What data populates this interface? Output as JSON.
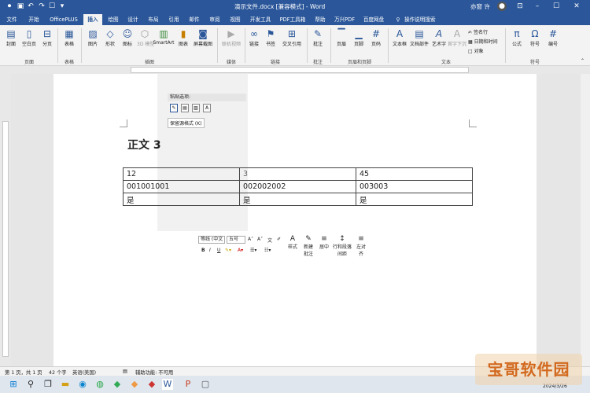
{
  "titlebar": {
    "title": "演示文件.docx [兼容模式] - Word",
    "user": "亦窗 许",
    "icons": [
      "save-icon",
      "undo-icon",
      "redo-icon",
      "touch-mode-icon",
      "customize-icon"
    ]
  },
  "tabs": [
    "文件",
    "开始",
    "OfficePLUS",
    "插入",
    "绘图",
    "设计",
    "布局",
    "引用",
    "邮件",
    "审阅",
    "视图",
    "开发工具",
    "PDF工具箱",
    "帮助",
    "万兴PDF",
    "百度网盘",
    "操作说明搜索"
  ],
  "active_tab": "插入",
  "ribbon": {
    "groups": {
      "pages": "页面",
      "tables": "表格",
      "illustrations": "插图",
      "media": "媒体",
      "links": "链接",
      "comments": "批注",
      "header_footer": "页眉和页脚",
      "text": "文本",
      "symbols": "符号"
    },
    "buttons": {
      "cover": "封面",
      "blank_page": "空白页",
      "page_break": "分页",
      "table": "表格",
      "picture": "图片",
      "shapes": "形状",
      "icons": "图标",
      "models_3d": "3D 模型",
      "smartart": "SmartArt",
      "chart": "图表",
      "screenshot": "屏幕截图",
      "online_video": "联机视频",
      "link": "链接",
      "bookmark": "书签",
      "cross_ref": "交叉引用",
      "comment": "批注",
      "header": "页眉",
      "footer": "页脚",
      "page_num": "页码",
      "textbox": "文本框",
      "quick_parts": "文档部件",
      "wordart": "艺术字",
      "dropcap": "首字下沉",
      "signature": "签名行",
      "datetime": "日期和时间",
      "object": "对象",
      "equation": "公式",
      "symbol": "符号",
      "number": "编号"
    }
  },
  "paste_popup": {
    "header": "粘贴选项:",
    "tooltip": "保留源格式 (K)"
  },
  "document": {
    "heading": "正文 3",
    "table": [
      [
        "12",
        "3",
        "45"
      ],
      [
        "001001001",
        "002002002",
        "003003"
      ],
      [
        "是",
        "是",
        "是"
      ]
    ]
  },
  "mini_toolbar": {
    "font": "等线 (中文",
    "size": "五号",
    "styles": "样式",
    "new_comment": "新建",
    "new_comment2": "批注",
    "center": "居中",
    "line_spacing": "行和段落",
    "line_spacing2": "间距",
    "left_align": "左对",
    "left_align2": "齐",
    "bold": "B",
    "italic": "I",
    "underline": "U"
  },
  "statusbar": {
    "page": "第 1 页，共 1 页",
    "words": "42 个字",
    "lang": "英语(美国)",
    "accessibility": "辅助功能: 不可用"
  },
  "taskbar": {
    "date": "2024/3/26"
  },
  "watermark": "宝哥软件园"
}
